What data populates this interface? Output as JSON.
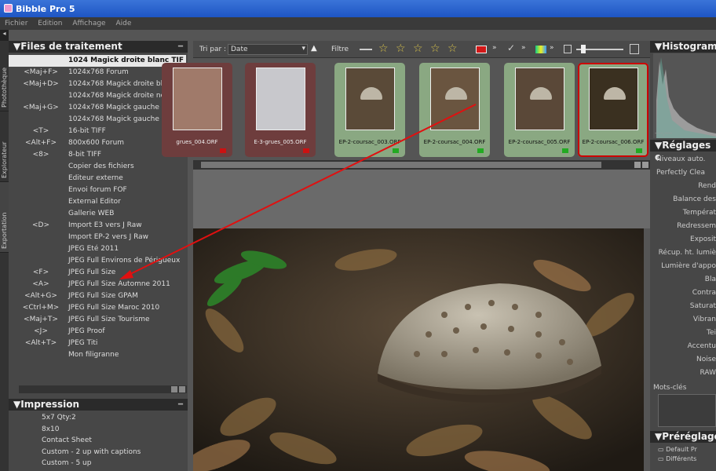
{
  "window": {
    "title": "Bibble Pro 5"
  },
  "menu": [
    "Fichier",
    "Edition",
    "Affichage",
    "Aide"
  ],
  "side_tabs": [
    "Photothèque",
    "Explorateur",
    "Exportation"
  ],
  "files_panel": {
    "title": "Files de traitement",
    "items": [
      {
        "shortcut": "",
        "name": "1024 Magick droite blanc TIF",
        "selected": true
      },
      {
        "shortcut": "<Maj+F>",
        "name": "1024x768 Forum"
      },
      {
        "shortcut": "<Maj+D>",
        "name": "1024x768 Magick droite blanc"
      },
      {
        "shortcut": "",
        "name": "1024x768 Magick droite noir"
      },
      {
        "shortcut": "<Maj+G>",
        "name": "1024x768 Magick gauche blanc"
      },
      {
        "shortcut": "",
        "name": "1024x768 Magick gauche noir"
      },
      {
        "shortcut": "<T>",
        "name": "16-bit TIFF"
      },
      {
        "shortcut": "<Alt+F>",
        "name": "800x600 Forum"
      },
      {
        "shortcut": "<8>",
        "name": "8-bit TIFF"
      },
      {
        "shortcut": "",
        "name": "Copier des fichiers"
      },
      {
        "shortcut": "",
        "name": "Editeur externe"
      },
      {
        "shortcut": "",
        "name": "Envoi forum FOF"
      },
      {
        "shortcut": "",
        "name": "External Editor"
      },
      {
        "shortcut": "",
        "name": "Gallerie WEB"
      },
      {
        "shortcut": "<D>",
        "name": "Import E3 vers J Raw"
      },
      {
        "shortcut": "",
        "name": "Import EP-2 vers J Raw"
      },
      {
        "shortcut": "",
        "name": "JPEG Eté 2011"
      },
      {
        "shortcut": "",
        "name": "JPEG Full Environs de Périgueux"
      },
      {
        "shortcut": "<F>",
        "name": "JPEG Full Size"
      },
      {
        "shortcut": "<A>",
        "name": "JPEG Full Size Automne 2011"
      },
      {
        "shortcut": "<Alt+G>",
        "name": "JPEG Full Size GPAM"
      },
      {
        "shortcut": "<Ctrl+M>",
        "name": "JPEG Full Size Maroc 2010"
      },
      {
        "shortcut": "<Maj+T>",
        "name": "JPEG Full Size Tourisme"
      },
      {
        "shortcut": "<J>",
        "name": "JPEG Proof"
      },
      {
        "shortcut": "<Alt+T>",
        "name": "JPEG Titi"
      },
      {
        "shortcut": "",
        "name": "Mon filigranne"
      }
    ]
  },
  "impression_panel": {
    "title": "Impression",
    "items": [
      "5x7 Qty:2",
      "8x10",
      "Contact Sheet",
      "Custom - 2 up with captions",
      "Custom - 5 up"
    ]
  },
  "toolbar": {
    "sort_label": "Tri par :",
    "sort_value": "Date",
    "filter_label": "Filtre"
  },
  "thumbnails": [
    {
      "name": "grues_004.ORF",
      "selected": false
    },
    {
      "name": "E-3-grues_005.ORF",
      "selected": false
    },
    {
      "name": "EP-2-coursac_003.ORF",
      "selected": true
    },
    {
      "name": "EP-2-coursac_004.ORF",
      "selected": true
    },
    {
      "name": "EP-2-coursac_005.ORF",
      "selected": true
    },
    {
      "name": "EP-2-coursac_006.ORF",
      "selected": true
    }
  ],
  "colors": {
    "selected_frame": "#8aa882",
    "unselected_frame": "#6e3d3d",
    "accent_arrow": "#e01010",
    "titlebar": "#2a62d0"
  },
  "right_panel": {
    "histogram_title": "Histogramme",
    "histogram_readout": "----,----",
    "settings_title": "Réglages c",
    "rows": [
      "Niveaux auto.",
      "Perfectly Clea",
      "Rend",
      "Balance des",
      "Températ",
      "Redressem",
      "Exposit",
      "Récup. ht. lumiè",
      "Lumière d'appo",
      "Bla",
      "Contra",
      "Saturat",
      "Vibran",
      "Tei",
      "Accentu",
      "Noise",
      "RAW"
    ],
    "keywords_label": "Mots-clés",
    "presets_title": "Préréglage",
    "presets": [
      "Default Pr",
      "Différents"
    ]
  }
}
